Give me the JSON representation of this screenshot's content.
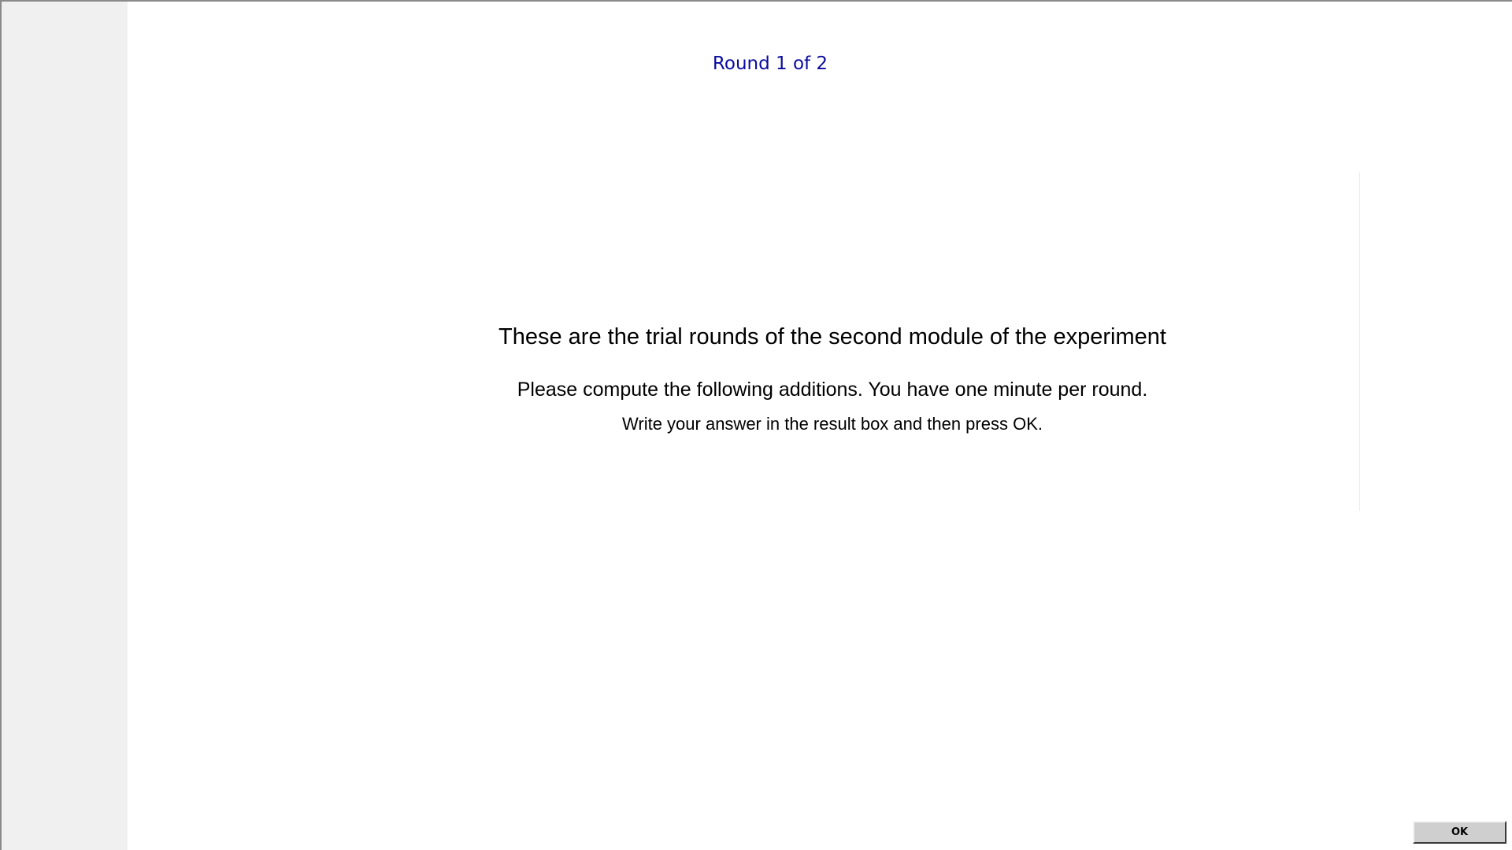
{
  "header": {
    "round_label": "Round 1 of 2"
  },
  "instructions": {
    "heading": "These are the trial rounds of the second module of the experiment",
    "line1": "Please compute the following additions. You have one minute per round.",
    "line2": "Write your answer in the result box and then press OK."
  },
  "footer": {
    "ok_label": "OK"
  },
  "colors": {
    "round_label": "#0a0aa0",
    "left_panel": "#f0f0f0",
    "button_face": "#cfcfcf"
  }
}
